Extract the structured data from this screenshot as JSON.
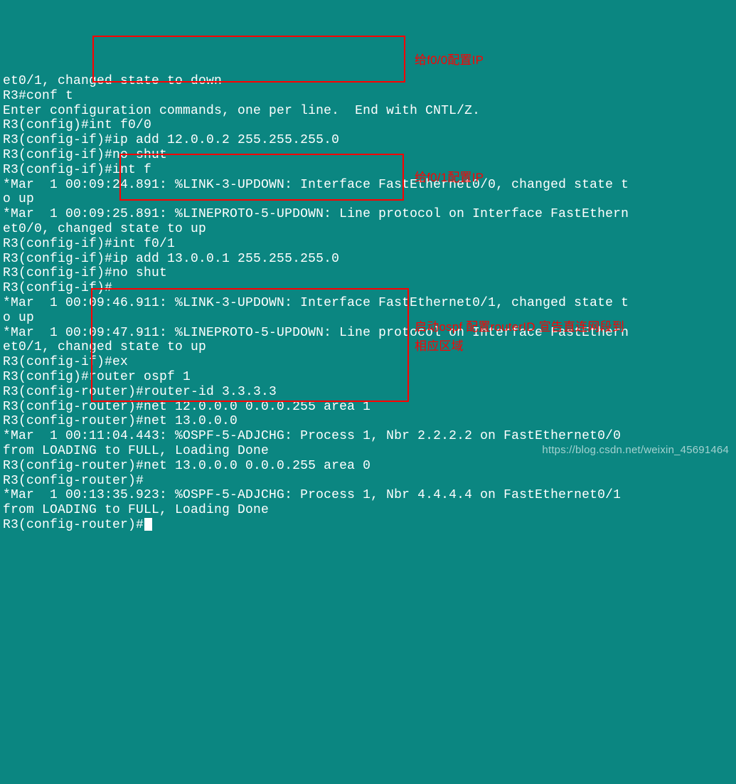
{
  "terminal": {
    "lines": [
      "et0/1, changed state to down",
      "R3#conf t",
      "Enter configuration commands, one per line.  End with CNTL/Z.",
      "R3(config)#int f0/0",
      "R3(config-if)#ip add 12.0.0.2 255.255.255.0",
      "R3(config-if)#no shut",
      "R3(config-if)#int f",
      "*Mar  1 00:09:24.891: %LINK-3-UPDOWN: Interface FastEthernet0/0, changed state t",
      "o up",
      "*Mar  1 00:09:25.891: %LINEPROTO-5-UPDOWN: Line protocol on Interface FastEthern",
      "et0/0, changed state to up",
      "R3(config-if)#int f0/1",
      "R3(config-if)#ip add 13.0.0.1 255.255.255.0",
      "R3(config-if)#no shut",
      "R3(config-if)#",
      "*Mar  1 00:09:46.911: %LINK-3-UPDOWN: Interface FastEthernet0/1, changed state t",
      "o up",
      "*Mar  1 00:09:47.911: %LINEPROTO-5-UPDOWN: Line protocol on Interface FastEthern",
      "et0/1, changed state to up",
      "R3(config-if)#ex",
      "R3(config)#router ospf 1",
      "R3(config-router)#router-id 3.3.3.3",
      "R3(config-router)#net 12.0.0.0 0.0.0.255 area 1",
      "R3(config-router)#net 13.0.0.0",
      "*Mar  1 00:11:04.443: %OSPF-5-ADJCHG: Process 1, Nbr 2.2.2.2 on FastEthernet0/0",
      "from LOADING to FULL, Loading Done",
      "R3(config-router)#net 13.0.0.0 0.0.0.255 area 0",
      "R3(config-router)#",
      "*Mar  1 00:13:35.923: %OSPF-5-ADJCHG: Process 1, Nbr 4.4.4.4 on FastEthernet0/1",
      "from LOADING to FULL, Loading Done",
      "R3(config-router)#"
    ]
  },
  "annotations": {
    "box1_label": "给f0/0配置IP",
    "box2_label": "给f0/1配置IP",
    "box3_label_line1": "启动ospf 配置routerID 宣告直连网段到",
    "box3_label_line2": "相应区域"
  },
  "watermark": "https://blog.csdn.net/weixin_45691464"
}
